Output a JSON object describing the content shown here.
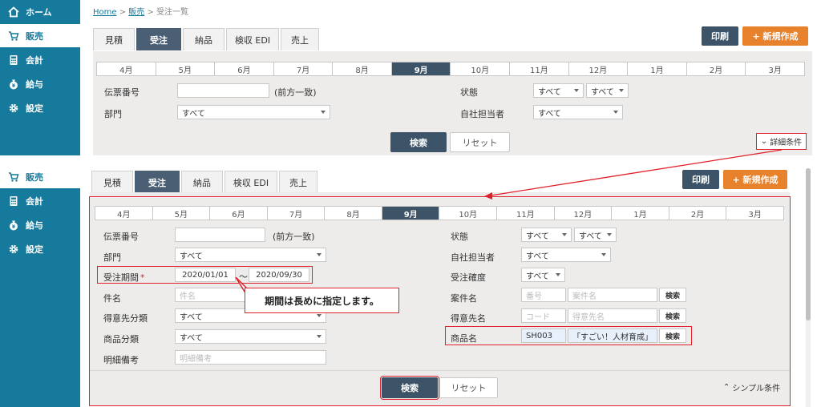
{
  "top": {
    "breadcrumb": {
      "home": "Home",
      "sep1": ">",
      "sales": "販売",
      "sep2": ">",
      "current": "受注一覧"
    },
    "sidebar": [
      {
        "label": "ホーム",
        "icon": "home-icon"
      },
      {
        "label": "販売",
        "icon": "cart-icon"
      },
      {
        "label": "会計",
        "icon": "calculator-icon"
      },
      {
        "label": "給与",
        "icon": "money-bag-icon"
      },
      {
        "label": "設定",
        "icon": "gear-icon"
      }
    ],
    "tabs": [
      "見積",
      "受注",
      "納品",
      "検収 EDI",
      "売上"
    ],
    "print": "印刷",
    "new": "+ 新規作成",
    "months": [
      "4月",
      "5月",
      "6月",
      "7月",
      "8月",
      "9月",
      "10月",
      "11月",
      "12月",
      "1月",
      "2月",
      "3月"
    ],
    "slip_label": "伝票番号",
    "slip_hint": "(前方一致)",
    "dept_label": "部門",
    "dept_value": "すべて",
    "status_label": "状態",
    "status_value1": "すべて",
    "status_value2": "すべて",
    "staff_label": "自社担当者",
    "staff_value": "すべて",
    "search": "検索",
    "reset": "リセット",
    "detail": "詳細条件"
  },
  "bottom": {
    "sidebar": [
      {
        "label": "販売",
        "icon": "cart-icon"
      },
      {
        "label": "会計",
        "icon": "calculator-icon"
      },
      {
        "label": "給与",
        "icon": "money-bag-icon"
      },
      {
        "label": "設定",
        "icon": "gear-icon"
      }
    ],
    "tabs": [
      "見積",
      "受注",
      "納品",
      "検収 EDI",
      "売上"
    ],
    "print": "印刷",
    "new": "+ 新規作成",
    "months": [
      "4月",
      "5月",
      "6月",
      "7月",
      "8月",
      "9月",
      "10月",
      "11月",
      "12月",
      "1月",
      "2月",
      "3月"
    ],
    "slip_label": "伝票番号",
    "slip_hint": "(前方一致)",
    "dept_label": "部門",
    "dept_value": "すべて",
    "period_label": "受注期間",
    "required_mark": "*",
    "period_from": "2020/01/01",
    "period_tilde": "〜",
    "period_to": "2020/09/30",
    "subject_label": "件名",
    "subject_ph": "件名",
    "customer_class_label": "得意先分類",
    "customer_class_value": "すべて",
    "product_class_label": "商品分類",
    "product_class_value": "すべて",
    "detail_note_label": "明細備考",
    "detail_note_ph": "明細備考",
    "status_label": "状態",
    "status_value1": "すべて",
    "status_value2": "すべて",
    "staff_label": "自社担当者",
    "staff_value": "すべて",
    "certainty_label": "受注確度",
    "certainty_value": "すべて",
    "project_label": "案件名",
    "project_code_ph": "番号",
    "project_name_ph": "案件名",
    "customer_label": "得意先名",
    "customer_code_ph": "コード",
    "customer_name_ph": "得意先名",
    "product_label": "商品名",
    "product_code": "SH003",
    "product_name": "「すごい！人材育成」",
    "lookup": "検索",
    "search": "検索",
    "reset": "リセット",
    "simple": "シンプル条件"
  },
  "callout": "期間は長めに指定します。",
  "colors": {
    "sidebar": "#157a9b",
    "dark": "#3d5468",
    "orange": "#e7812c",
    "highlight": "#e0202a"
  }
}
